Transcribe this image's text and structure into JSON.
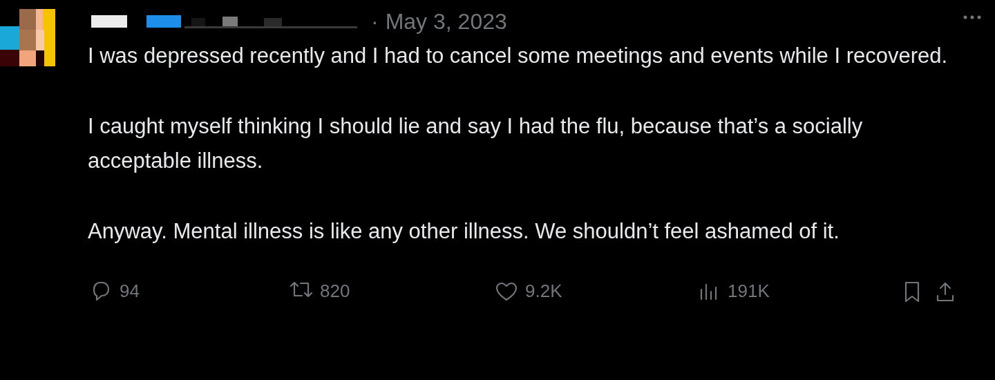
{
  "post": {
    "separator": "·",
    "date": "May 3, 2023",
    "paragraphs": [
      "I was depressed recently and I had to cancel some meetings and events while I recovered.",
      "I caught myself thinking I should lie and say I had the flu, because that’s a socially acceptable illness.",
      "Anyway. Mental illness is like any other illness. We shouldn’t feel ashamed of it."
    ],
    "actions": [
      {
        "kind": "reply",
        "count": "94"
      },
      {
        "kind": "repost",
        "count": "820"
      },
      {
        "kind": "like",
        "count": "9.2K"
      },
      {
        "kind": "views",
        "count": "191K"
      },
      {
        "kind": "bookmark"
      },
      {
        "kind": "share"
      }
    ]
  }
}
